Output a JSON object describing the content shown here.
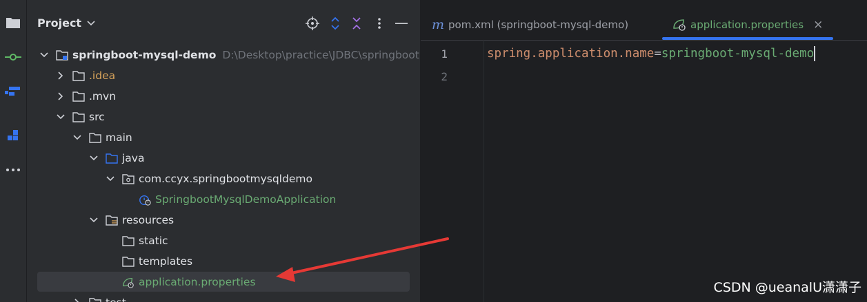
{
  "project_panel": {
    "title": "Project",
    "tree": [
      {
        "label": "springboot-mysql-demo",
        "path": "D:\\Desktop\\practice\\JDBC\\springboot",
        "icon": "module-folder-icon",
        "expanded": true,
        "bold": true
      },
      {
        "label": ".idea",
        "icon": "folder-icon",
        "expanded": false,
        "color": "#d9a45b"
      },
      {
        "label": ".mvn",
        "icon": "folder-icon",
        "expanded": false
      },
      {
        "label": "src",
        "icon": "folder-icon",
        "expanded": true
      },
      {
        "label": "main",
        "icon": "folder-icon",
        "expanded": true
      },
      {
        "label": "java",
        "icon": "source-folder-icon",
        "expanded": true
      },
      {
        "label": "com.ccyx.springbootmysqldemo",
        "icon": "package-icon",
        "expanded": true
      },
      {
        "label": "SpringbootMysqlDemoApplication",
        "icon": "spring-class-icon",
        "color": "#6aab73"
      },
      {
        "label": "resources",
        "icon": "resources-folder-icon",
        "expanded": true
      },
      {
        "label": "static",
        "icon": "folder-icon"
      },
      {
        "label": "templates",
        "icon": "folder-icon"
      },
      {
        "label": "application.properties",
        "icon": "spring-properties-icon",
        "color": "#6aab73",
        "selected": true
      },
      {
        "label": "test",
        "icon": "folder-icon",
        "expanded": false
      }
    ]
  },
  "editor": {
    "tabs": [
      {
        "label": "pom.xml (springboot-mysql-demo)",
        "icon": "maven-icon",
        "active": false
      },
      {
        "label": "application.properties",
        "icon": "spring-properties-icon",
        "active": true,
        "close": "×"
      }
    ],
    "lines": [
      {
        "number": "1",
        "key": "spring.application.name",
        "eq": "=",
        "value": "springboot-mysql-demo"
      },
      {
        "number": "2"
      }
    ]
  },
  "watermark": "CSDN @ueanalU潇潇子",
  "colors": {
    "accent": "#3574f0",
    "arrow": "#e53935",
    "spring_green": "#6aab73"
  }
}
